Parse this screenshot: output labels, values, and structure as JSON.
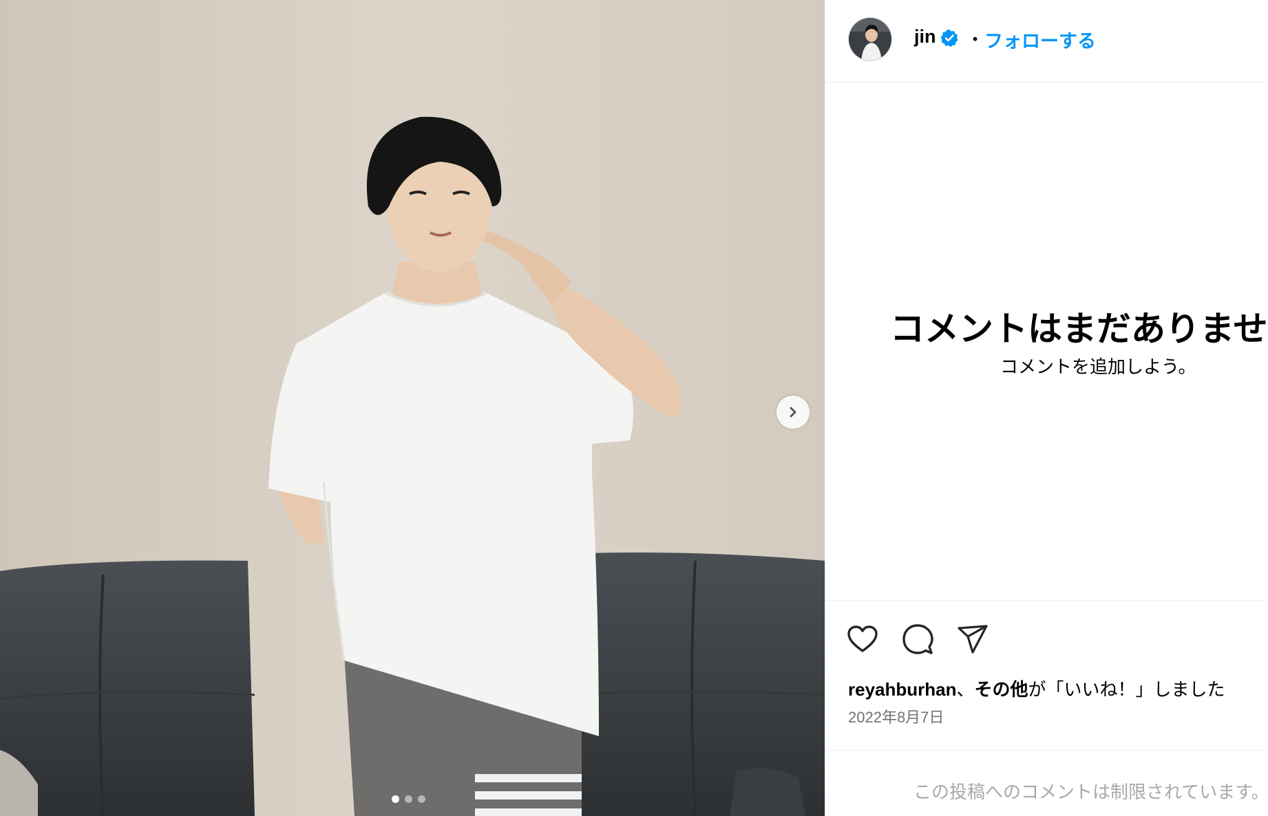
{
  "post": {
    "carousel": {
      "count": 3,
      "active_index": 0
    },
    "photo_alt": "Photo by jin"
  },
  "header": {
    "username": "jin",
    "separator": "・",
    "follow_label": "フォローする",
    "verified_color": "#0095f6"
  },
  "comments": {
    "empty_title": "コメントはまだありません。",
    "empty_subtitle": "コメントを追加しよう。"
  },
  "actions": {
    "like_icon": "heart-icon",
    "comment_icon": "comment-icon",
    "share_icon": "send-icon"
  },
  "likes": {
    "user": "reyahburhan",
    "separator": "、",
    "others": "その他",
    "suffix": "が「いいね！」しました"
  },
  "date": "2022年8月7日",
  "restricted_notice": "この投稿へのコメントは制限されています。"
}
